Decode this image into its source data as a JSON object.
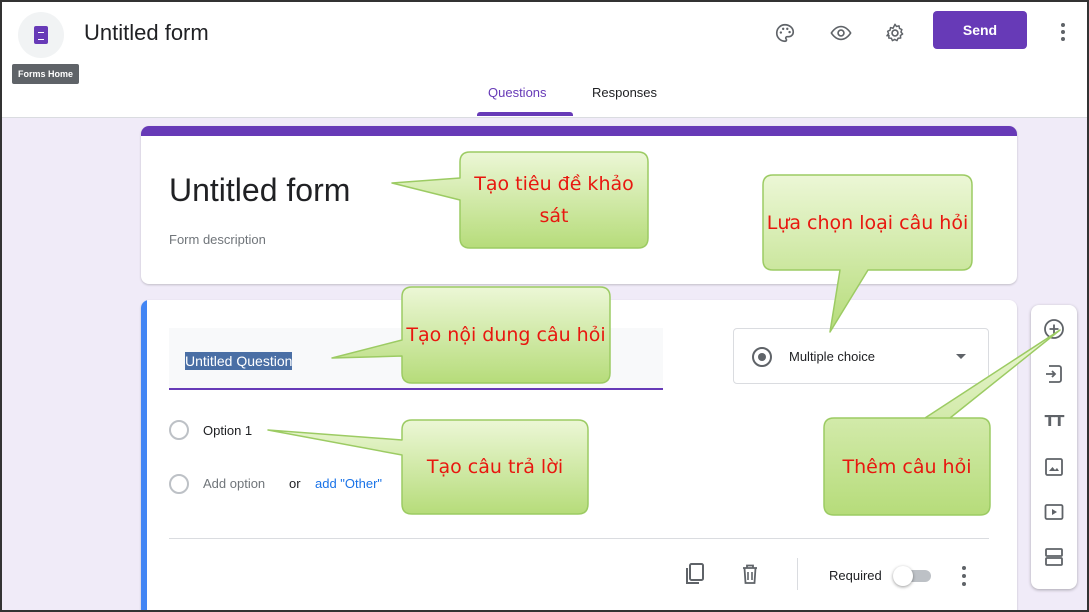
{
  "header": {
    "doc_title": "Untitled form",
    "tooltip": "Forms Home",
    "send_label": "Send",
    "icons": [
      "palette-icon",
      "eye-icon",
      "gear-icon",
      "more-vert-icon"
    ],
    "tabs": [
      {
        "label": "Questions",
        "active": true
      },
      {
        "label": "Responses",
        "active": false
      }
    ]
  },
  "title_card": {
    "title": "Untitled form",
    "description": "Form description"
  },
  "question": {
    "title": "Untitled Question",
    "type_label": "Multiple choice",
    "option1": "Option 1",
    "add_option": "Add option",
    "or": "or",
    "add_other": "add \"Other\"",
    "required_label": "Required",
    "required": false
  },
  "toolbar": {
    "items": [
      "add-question-icon",
      "import-questions-icon",
      "add-title-icon",
      "add-image-icon",
      "add-video-icon",
      "add-section-icon"
    ]
  },
  "callouts": {
    "title": "Tạo tiêu đề khảo sát",
    "type": "Lựa chọn loại câu hỏi",
    "question": "Tạo nội dung câu hỏi",
    "answer": "Tạo câu trả lời",
    "add": "Thêm câu hỏi"
  },
  "colors": {
    "accent": "#673ab7",
    "background": "#f0ebf8",
    "callout_fill": "#c9e89b",
    "callout_text": "#e8170f",
    "question_bar": "#4285f4"
  }
}
